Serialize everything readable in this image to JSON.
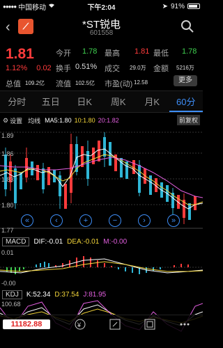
{
  "status": {
    "carrier": "中国移动",
    "time": "下午2:04",
    "battery": "91%"
  },
  "header": {
    "title": "*ST锐电",
    "code": "601558"
  },
  "quote": {
    "price": "1.81",
    "change_pct": "1.12%",
    "change": "0.02",
    "fields": [
      {
        "label": "今开",
        "value": "1.78",
        "color": "green"
      },
      {
        "label": "最高",
        "value": "1.81",
        "color": "red"
      },
      {
        "label": "最低",
        "value": "1.78",
        "color": "green"
      },
      {
        "label": "换手",
        "value": "0.51%",
        "color": "white"
      },
      {
        "label": "成交",
        "value": "29.0万",
        "color": "white"
      },
      {
        "label": "金额",
        "value": "5216万",
        "color": "white"
      },
      {
        "label": "总值",
        "value": "109.2亿",
        "color": "white"
      },
      {
        "label": "流值",
        "value": "102.5亿",
        "color": "white"
      },
      {
        "label": "市盈(动)",
        "value": "12.58",
        "color": "white"
      }
    ],
    "more": "更多"
  },
  "tabs": [
    {
      "label": "分时",
      "active": false
    },
    {
      "label": "五日",
      "active": false
    },
    {
      "label": "日K",
      "active": false
    },
    {
      "label": "周K",
      "active": false
    },
    {
      "label": "月K",
      "active": false
    },
    {
      "label": "60分",
      "active": true
    }
  ],
  "ma": {
    "settings": "设置",
    "label": "均线",
    "ma5": "MA5:1.80",
    "ma10": "10:1.80",
    "ma20": "20:1.82",
    "fq": "前复权"
  },
  "kchart": {
    "top": "1.89",
    "mid1": "1.86",
    "mid2": "1.83",
    "mid3": "1.80",
    "bottom": "1.77"
  },
  "navbtns": [
    "«",
    "‹",
    "+",
    "−",
    "›",
    "»"
  ],
  "macd": {
    "tag": "MACD",
    "dif": "DIF:-0.01",
    "dea": "DEA:-0.01",
    "m": "M:-0.00",
    "top": "0.01",
    "bottom": "-0.00"
  },
  "kdj": {
    "tag": "KDJ",
    "k": "K:52.34",
    "d": "D:37.54",
    "j": "J:81.95",
    "top": "100.68"
  },
  "bottom": {
    "index": "11182.88"
  },
  "colors": {
    "up": "#ff3b3b",
    "down": "#3fd04f",
    "accent": "#3e8ef7",
    "ma10": "#f2d43a",
    "ma20": "#e35fe0"
  }
}
